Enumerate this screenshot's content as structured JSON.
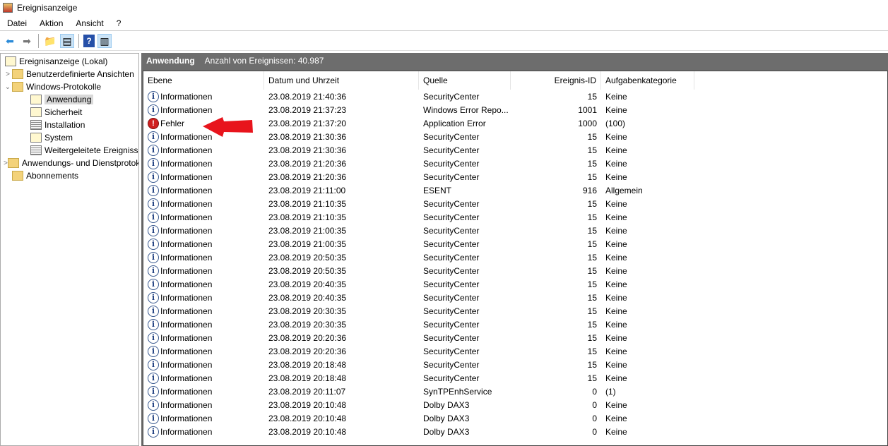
{
  "window": {
    "title": "Ereignisanzeige"
  },
  "menu": [
    "Datei",
    "Aktion",
    "Ansicht",
    "?"
  ],
  "tree": {
    "root": "Ereignisanzeige (Lokal)",
    "custom": "Benutzerdefinierte Ansichten",
    "winlogs": "Windows-Protokolle",
    "app": "Anwendung",
    "security": "Sicherheit",
    "setup": "Installation",
    "system": "System",
    "forwarded": "Weitergeleitete Ereignisse",
    "appsvc": "Anwendungs- und Dienstprotokolle",
    "subs": "Abonnements"
  },
  "panel": {
    "title": "Anwendung",
    "count": "Anzahl von Ereignissen: 40.987"
  },
  "columns": [
    "Ebene",
    "Datum und Uhrzeit",
    "Quelle",
    "Ereignis-ID",
    "Aufgabenkategorie"
  ],
  "rows": [
    [
      "info",
      "Informationen",
      "23.08.2019 21:40:36",
      "SecurityCenter",
      "15",
      "Keine"
    ],
    [
      "info",
      "Informationen",
      "23.08.2019 21:37:23",
      "Windows Error Repo...",
      "1001",
      "Keine"
    ],
    [
      "error",
      "Fehler",
      "23.08.2019 21:37:20",
      "Application Error",
      "1000",
      "(100)"
    ],
    [
      "info",
      "Informationen",
      "23.08.2019 21:30:36",
      "SecurityCenter",
      "15",
      "Keine"
    ],
    [
      "info",
      "Informationen",
      "23.08.2019 21:30:36",
      "SecurityCenter",
      "15",
      "Keine"
    ],
    [
      "info",
      "Informationen",
      "23.08.2019 21:20:36",
      "SecurityCenter",
      "15",
      "Keine"
    ],
    [
      "info",
      "Informationen",
      "23.08.2019 21:20:36",
      "SecurityCenter",
      "15",
      "Keine"
    ],
    [
      "info",
      "Informationen",
      "23.08.2019 21:11:00",
      "ESENT",
      "916",
      "Allgemein"
    ],
    [
      "info",
      "Informationen",
      "23.08.2019 21:10:35",
      "SecurityCenter",
      "15",
      "Keine"
    ],
    [
      "info",
      "Informationen",
      "23.08.2019 21:10:35",
      "SecurityCenter",
      "15",
      "Keine"
    ],
    [
      "info",
      "Informationen",
      "23.08.2019 21:00:35",
      "SecurityCenter",
      "15",
      "Keine"
    ],
    [
      "info",
      "Informationen",
      "23.08.2019 21:00:35",
      "SecurityCenter",
      "15",
      "Keine"
    ],
    [
      "info",
      "Informationen",
      "23.08.2019 20:50:35",
      "SecurityCenter",
      "15",
      "Keine"
    ],
    [
      "info",
      "Informationen",
      "23.08.2019 20:50:35",
      "SecurityCenter",
      "15",
      "Keine"
    ],
    [
      "info",
      "Informationen",
      "23.08.2019 20:40:35",
      "SecurityCenter",
      "15",
      "Keine"
    ],
    [
      "info",
      "Informationen",
      "23.08.2019 20:40:35",
      "SecurityCenter",
      "15",
      "Keine"
    ],
    [
      "info",
      "Informationen",
      "23.08.2019 20:30:35",
      "SecurityCenter",
      "15",
      "Keine"
    ],
    [
      "info",
      "Informationen",
      "23.08.2019 20:30:35",
      "SecurityCenter",
      "15",
      "Keine"
    ],
    [
      "info",
      "Informationen",
      "23.08.2019 20:20:36",
      "SecurityCenter",
      "15",
      "Keine"
    ],
    [
      "info",
      "Informationen",
      "23.08.2019 20:20:36",
      "SecurityCenter",
      "15",
      "Keine"
    ],
    [
      "info",
      "Informationen",
      "23.08.2019 20:18:48",
      "SecurityCenter",
      "15",
      "Keine"
    ],
    [
      "info",
      "Informationen",
      "23.08.2019 20:18:48",
      "SecurityCenter",
      "15",
      "Keine"
    ],
    [
      "info",
      "Informationen",
      "23.08.2019 20:11:07",
      "SynTPEnhService",
      "0",
      "(1)"
    ],
    [
      "info",
      "Informationen",
      "23.08.2019 20:10:48",
      "Dolby DAX3",
      "0",
      "Keine"
    ],
    [
      "info",
      "Informationen",
      "23.08.2019 20:10:48",
      "Dolby DAX3",
      "0",
      "Keine"
    ],
    [
      "info",
      "Informationen",
      "23.08.2019 20:10:48",
      "Dolby DAX3",
      "0",
      "Keine"
    ]
  ],
  "colors": {
    "annotation_arrow": "#e8141c",
    "panel_header": "#6d6d6d"
  }
}
